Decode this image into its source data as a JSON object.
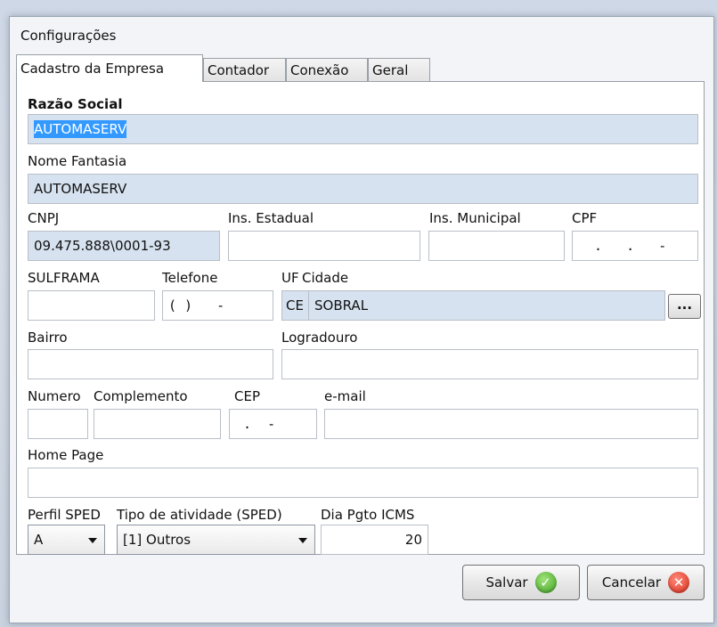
{
  "window": {
    "title": "Configurações"
  },
  "tabs": [
    {
      "label": "Cadastro da Empresa"
    },
    {
      "label": "Contador"
    },
    {
      "label": "Conexão"
    },
    {
      "label": "Geral"
    }
  ],
  "form": {
    "razao_social": {
      "label": "Razão Social",
      "value": "AUTOMASERV"
    },
    "nome_fantasia": {
      "label": "Nome Fantasia",
      "value": "AUTOMASERV"
    },
    "cnpj": {
      "label": "CNPJ",
      "value": "09.475.888\\0001-93"
    },
    "ins_estadual": {
      "label": "Ins. Estadual",
      "value": ""
    },
    "ins_municipal": {
      "label": "Ins. Municipal",
      "value": ""
    },
    "cpf": {
      "label": "CPF",
      "value": "  .   .   -"
    },
    "sulframa": {
      "label": "SULFRAMA",
      "value": ""
    },
    "telefone": {
      "label": "Telefone",
      "value": "( )   -"
    },
    "uf": {
      "label": "UF",
      "value": "CE"
    },
    "cidade": {
      "label": "Cidade",
      "value": "SOBRAL",
      "button_label": "..."
    },
    "bairro": {
      "label": "Bairro",
      "value": ""
    },
    "logradouro": {
      "label": "Logradouro",
      "value": ""
    },
    "numero": {
      "label": "Numero",
      "value": ""
    },
    "complemento": {
      "label": "Complemento",
      "value": ""
    },
    "cep": {
      "label": "CEP",
      "value": " .  -"
    },
    "email": {
      "label": "e-mail",
      "value": ""
    },
    "home_page": {
      "label": "Home Page",
      "value": ""
    },
    "perfil_sped": {
      "label": "Perfil SPED",
      "value": "A"
    },
    "tipo_atividade": {
      "label": "Tipo de atividade (SPED)",
      "value": "[1] Outros"
    },
    "dia_pgto_icms": {
      "label": "Dia Pgto ICMS",
      "value": "20"
    }
  },
  "footer": {
    "save_label": "Salvar",
    "cancel_label": "Cancelar"
  },
  "colors": {
    "filled_field": "#d6e2ef",
    "selection": "#3399ff",
    "save_icon": "#3fa321",
    "cancel_icon": "#d92d1a"
  },
  "icons": {
    "save": "check-circle-icon",
    "cancel": "x-circle-icon"
  }
}
